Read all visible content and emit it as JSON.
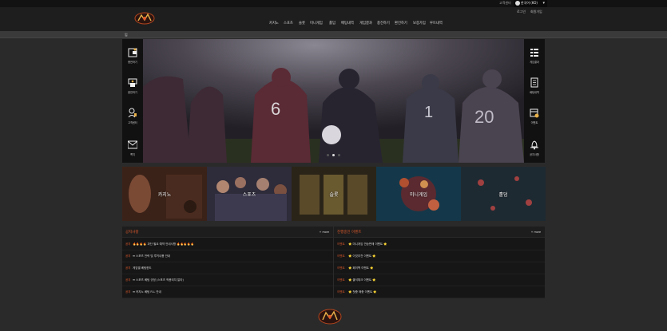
{
  "topbar": {
    "help_label": "고객센터",
    "language": "한국어 (KO)"
  },
  "header": {
    "login_label": "로그인",
    "signup_label": "회원가입",
    "nav": [
      "카지노",
      "스포츠",
      "슬롯",
      "미니게임",
      "홀덤",
      "배팅내역",
      "게임결과",
      "충전하기",
      "환전하기",
      "보증가입",
      "루트내역"
    ]
  },
  "subbar": {
    "label": "입"
  },
  "left_sidebar": [
    {
      "label": "충전하기",
      "icon": "wallet-icon"
    },
    {
      "label": "환전하기",
      "icon": "exchange-icon"
    },
    {
      "label": "고객센터",
      "icon": "support-icon"
    },
    {
      "label": "쪽지",
      "icon": "mail-icon"
    }
  ],
  "right_sidebar": [
    {
      "label": "게임결과",
      "icon": "list-icon"
    },
    {
      "label": "배팅내역",
      "icon": "document-icon"
    },
    {
      "label": "이벤트",
      "icon": "calendar-check-icon"
    },
    {
      "label": "공지사항",
      "icon": "bell-icon"
    }
  ],
  "hero": {
    "slides": 3,
    "active_slide": 2
  },
  "tiles": [
    {
      "label": "카지노"
    },
    {
      "label": "스포츠"
    },
    {
      "label": "슬롯"
    },
    {
      "label": "미니게임"
    },
    {
      "label": "홀덤"
    }
  ],
  "notice_panel": {
    "title": "공지사항",
    "more_label": "+ more",
    "rows": [
      {
        "cat": "공지",
        "text": "🔥🔥🔥🔥 과단 필요 예약 안내사항 🔥🔥🔥🔥🔥"
      },
      {
        "cat": "공지",
        "text": "➡ 스포츠 전략 및 루키내용 안내"
      },
      {
        "cat": "공지",
        "text": "게임별 베팅한도"
      },
      {
        "cat": "공지",
        "text": "➡ 스포츠 베팅 규정 (스포츠 적용되지 말라)"
      },
      {
        "cat": "공지",
        "text": "➡ 카지노 베팅 FLL 안내"
      }
    ]
  },
  "event_panel": {
    "title": "진행중인 이벤트",
    "more_label": "+ more",
    "rows": [
      {
        "cat": "이벤트",
        "text": "🌟 미니게임 연승판매 이벤트 🌟"
      },
      {
        "cat": "이벤트",
        "text": "🌟 이것추천 이벤트 🌟"
      },
      {
        "cat": "이벤트",
        "text": "🌟 페이백 이벤트 🌟"
      },
      {
        "cat": "이벤트",
        "text": "🌟 출석체크 이벤트 🌟"
      },
      {
        "cat": "이벤트",
        "text": "🌟 첫충 매충 이벤트 🌟"
      }
    ]
  },
  "colors": {
    "accent": "#e05a2b",
    "bg": "#2a2a2a",
    "panel": "#161616"
  }
}
